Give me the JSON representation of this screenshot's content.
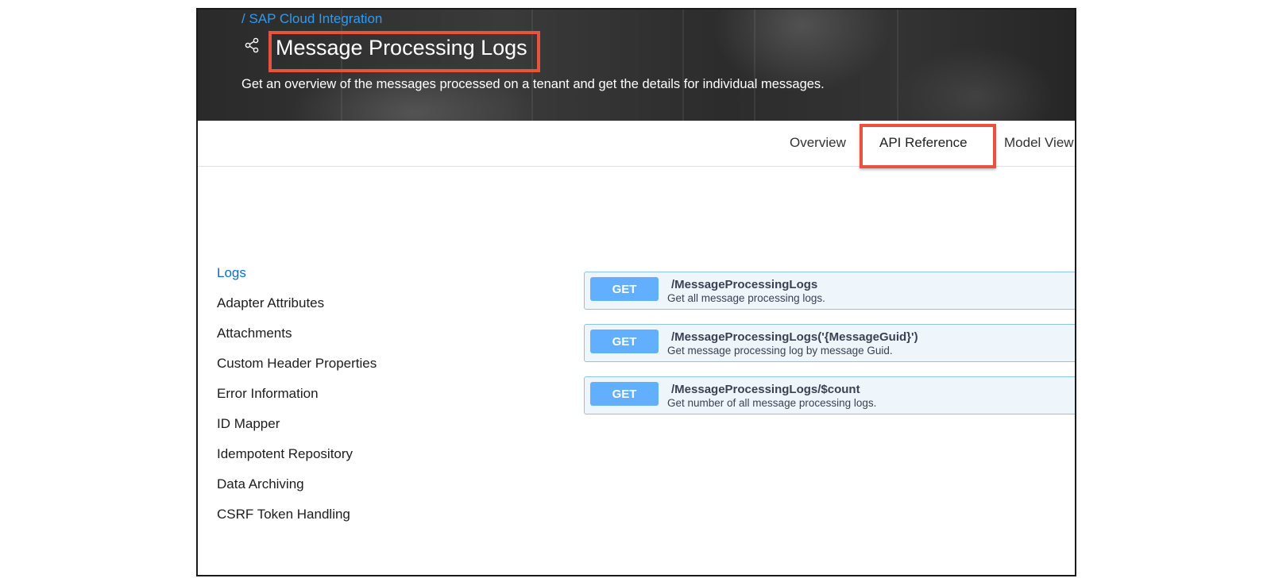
{
  "header": {
    "breadcrumb": "/ SAP Cloud Integration",
    "title": "Message Processing Logs",
    "subtitle": "Get an overview of the messages processed on a tenant and get the details for individual messages."
  },
  "tabs": [
    {
      "label": "Overview"
    },
    {
      "label": "API Reference",
      "active": true
    },
    {
      "label": "Model View"
    }
  ],
  "sidebar": {
    "items": [
      {
        "label": "Logs",
        "active": true
      },
      {
        "label": "Adapter Attributes"
      },
      {
        "label": "Attachments"
      },
      {
        "label": "Custom Header Properties"
      },
      {
        "label": "Error Information"
      },
      {
        "label": "ID Mapper"
      },
      {
        "label": "Idempotent Repository"
      },
      {
        "label": "Data Archiving"
      },
      {
        "label": "CSRF Token Handling"
      }
    ]
  },
  "endpoints": [
    {
      "method": "GET",
      "path": "/MessageProcessingLogs",
      "description": "Get all message processing logs."
    },
    {
      "method": "GET",
      "path": "/MessageProcessingLogs('{MessageGuid}')",
      "description": "Get message processing log by message Guid."
    },
    {
      "method": "GET",
      "path": "/MessageProcessingLogs/$count",
      "description": "Get number of all message processing logs."
    }
  ],
  "colors": {
    "highlight": "#e8533f",
    "link": "#0a6ed1",
    "breadcrumb": "#2f9bef",
    "get_badge": "#61affe"
  },
  "icons": {
    "share": "share-icon"
  }
}
